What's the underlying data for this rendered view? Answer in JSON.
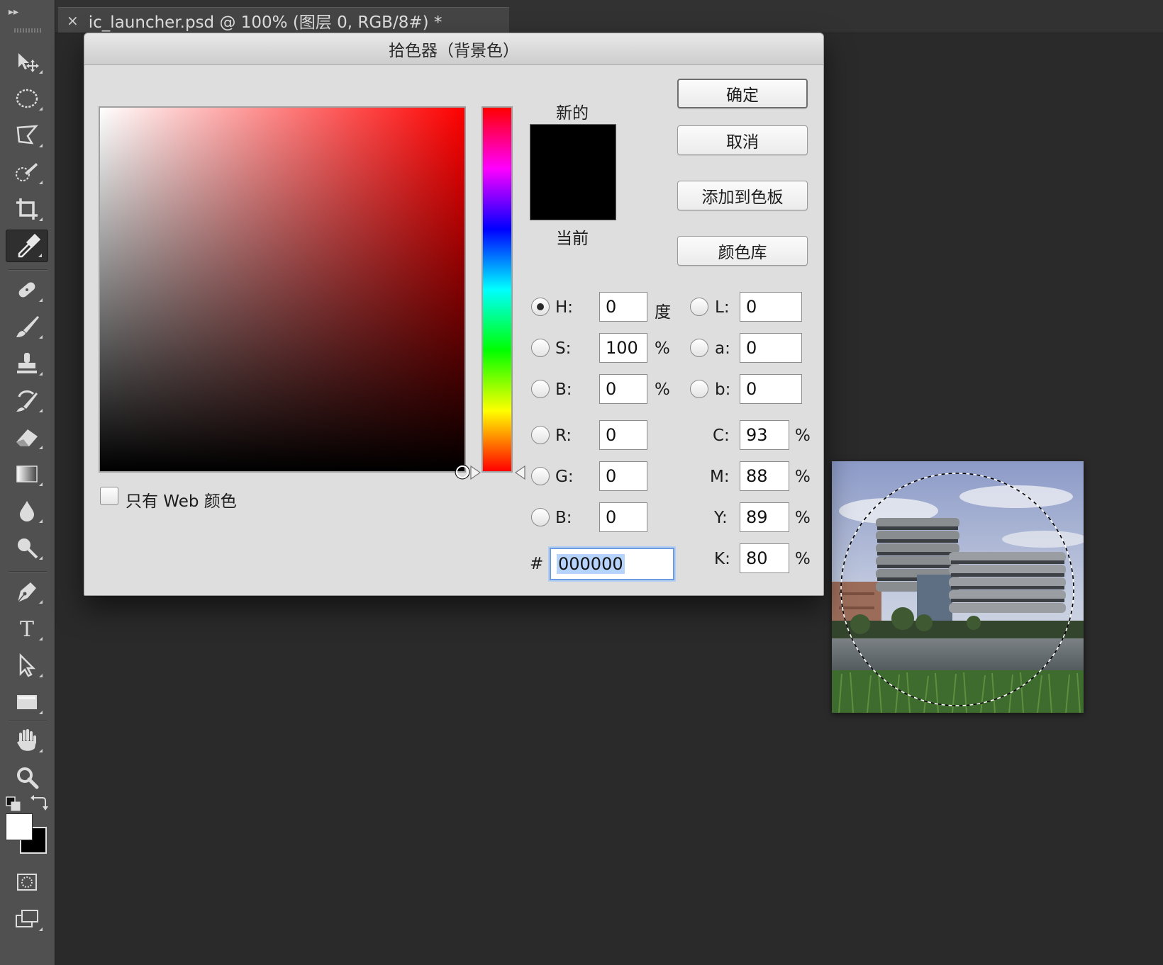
{
  "document_tab": {
    "close_glyph": "×",
    "title": "ic_launcher.psd @ 100% (图层 0, RGB/8#) *"
  },
  "toolbar": {
    "collapse_glyph": "▸▸",
    "tools": [
      "move-tool",
      "elliptical-marquee-tool",
      "polygonal-lasso-tool",
      "quick-selection-tool",
      "crop-tool",
      "eyedropper-tool",
      "spot-healing-brush-tool",
      "brush-tool",
      "clone-stamp-tool",
      "history-brush-tool",
      "eraser-tool",
      "gradient-tool",
      "blur-tool",
      "dodge-tool",
      "pen-tool",
      "type-tool",
      "path-selection-tool",
      "rectangle-tool",
      "hand-tool",
      "zoom-tool",
      "quick-mask-mode",
      "screen-mode"
    ],
    "active_tool": "eyedropper-tool",
    "foreground_color": "#ffffff",
    "background_color": "#000000"
  },
  "dialog": {
    "title": "拾色器（背景色）",
    "new_label": "新的",
    "current_label": "当前",
    "new_color": "#000000",
    "current_color": "#000000",
    "buttons": {
      "ok": "确定",
      "cancel": "取消",
      "add_to_swatches": "添加到色板",
      "color_libraries": "颜色库"
    },
    "web_only_label": "只有 Web 颜色",
    "web_only_checked": false,
    "hsb": {
      "h_label": "H:",
      "h_value": "0",
      "h_unit": "度",
      "s_label": "S:",
      "s_value": "100",
      "s_unit": "%",
      "b_label": "B:",
      "b_value": "0",
      "b_unit": "%",
      "selected": "H"
    },
    "lab": {
      "l_label": "L:",
      "l_value": "0",
      "a_label": "a:",
      "a_value": "0",
      "b_label": "b:",
      "b_value": "0"
    },
    "rgb": {
      "r_label": "R:",
      "r_value": "0",
      "g_label": "G:",
      "g_value": "0",
      "b_label": "B:",
      "b_value": "0"
    },
    "cmyk": {
      "c_label": "C:",
      "c_value": "93",
      "m_label": "M:",
      "m_value": "88",
      "y_label": "Y:",
      "y_value": "89",
      "k_label": "K:",
      "k_value": "80",
      "unit": "%"
    },
    "hex_label": "#",
    "hex_value": "000000",
    "field_hue_color": "#ff0000"
  }
}
